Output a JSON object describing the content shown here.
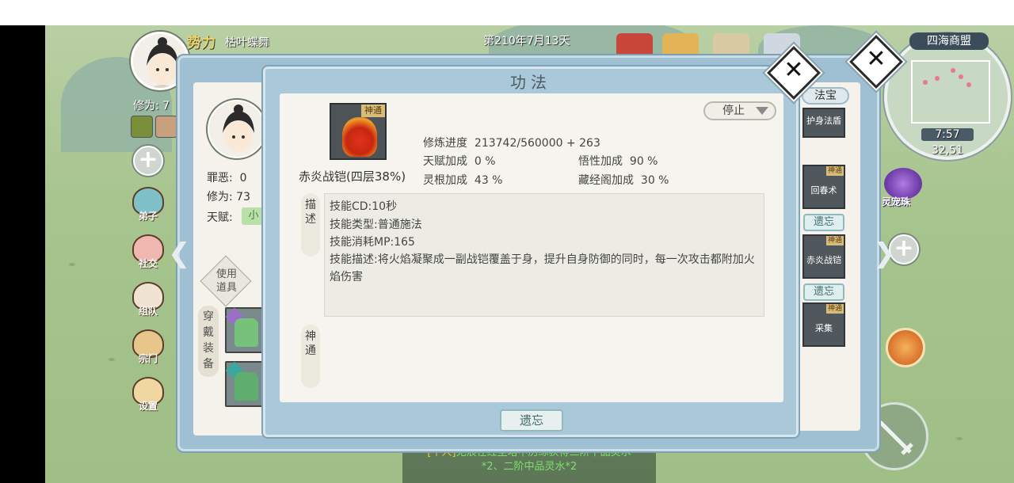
{
  "hud": {
    "faction_label": "势力",
    "player_name": "枯叶蝶舞",
    "date": "第210年7月13天",
    "cultivation_short": "修为: 7"
  },
  "side_menu": [
    {
      "label": "弟子",
      "icon": "disciple-icon"
    },
    {
      "label": "社交",
      "icon": "social-icon"
    },
    {
      "label": "组队",
      "icon": "team-icon"
    },
    {
      "label": "宗门",
      "icon": "sect-icon"
    },
    {
      "label": "设置",
      "icon": "settings-icon"
    }
  ],
  "minimap": {
    "title": "四海商盟",
    "time": "7:57",
    "coords": "32,51"
  },
  "right_orb_label": "灵宠珠",
  "character_panel": {
    "sin_label": "罪恶:",
    "sin_value": "0",
    "cultivation_label": "修为:",
    "cultivation_value": "73",
    "talent_label": "天赋:",
    "talent_value": "小",
    "use_item": "使用道具",
    "equip_tab": "穿戴装备"
  },
  "skill_list": {
    "tab": "法宝",
    "items": [
      {
        "name": "护身法盾",
        "badge": ""
      },
      {
        "name": "回春术",
        "badge": "神通"
      },
      {
        "name": "赤炎战铠",
        "badge": "神通"
      },
      {
        "name": "采集",
        "badge": "神通"
      }
    ],
    "forget_label": "遗忘"
  },
  "dialog": {
    "title": "功法",
    "stop_label": "停止",
    "skill_badge": "神通",
    "skill_name": "赤炎战铠(四层38%)",
    "progress_label": "修炼进度",
    "progress_value": "213742/560000 + 263",
    "talent_bonus_label": "天赋加成",
    "talent_bonus_value": "0 %",
    "insight_bonus_label": "悟性加成",
    "insight_bonus_value": "90 %",
    "root_bonus_label": "灵根加成",
    "root_bonus_value": "43 %",
    "library_bonus_label": "藏经阁加成",
    "library_bonus_value": "30 %",
    "desc_tab": "描述",
    "shen_tab": "神通",
    "desc_lines": [
      "技能CD:10秒",
      "技能类型:普通施法",
      "技能消耗MP:165",
      "技能描述:将火焰凝聚成一副战铠覆盖于身，提升自身防御的同时，每一次攻击都附加火焰伤害"
    ],
    "forget_label": "遗忘"
  },
  "chat": {
    "tag": "[个人]",
    "line1": "无痕在红尘塔中历练获得三阶下品灵水",
    "line2": "*2、二阶中品灵水*2"
  },
  "colors": {
    "panel_blue": "#a9c8da",
    "paper": "#f5f4ee",
    "chat_green": "#7ce26a",
    "faction_gold": "#e9d46a"
  }
}
